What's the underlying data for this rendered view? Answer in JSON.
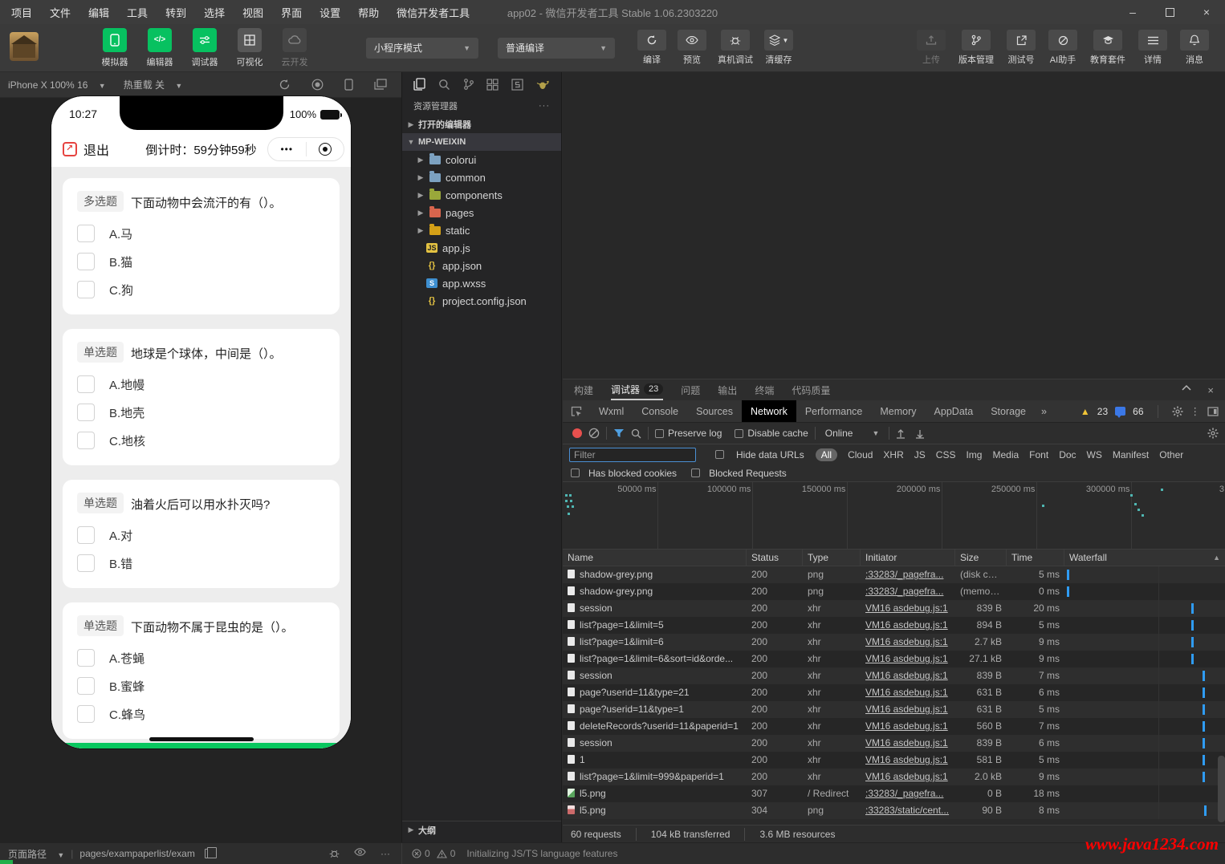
{
  "colors": {
    "accent_green": "#07c160",
    "waterfall_blue": "#2f9cf4",
    "warning_yellow": "#f0c437",
    "record_red": "#e8504e",
    "watermark_red": "#ff0000"
  },
  "window": {
    "title": "app02 - 微信开发者工具 Stable 1.06.2303220"
  },
  "menubar": {
    "items": [
      "项目",
      "文件",
      "编辑",
      "工具",
      "转到",
      "选择",
      "视图",
      "界面",
      "设置",
      "帮助",
      "微信开发者工具"
    ]
  },
  "toolbar": {
    "primary_buttons": [
      {
        "label": "模拟器",
        "icon": "phone-icon",
        "state": "green"
      },
      {
        "label": "编辑器",
        "icon": "code-icon",
        "state": "green"
      },
      {
        "label": "调试器",
        "icon": "sliders-icon",
        "state": "green"
      },
      {
        "label": "可视化",
        "icon": "layout-icon",
        "state": "grey"
      },
      {
        "label": "云开发",
        "icon": "cloud-icon",
        "state": "disabled"
      }
    ],
    "mode_select": "小程序模式",
    "compile_select": "普通编译",
    "action_buttons": [
      {
        "label": "编译",
        "icon": "compile-refresh-icon"
      },
      {
        "label": "预览",
        "icon": "eye-icon"
      },
      {
        "label": "真机调试",
        "icon": "bug-icon"
      },
      {
        "label": "清缓存",
        "icon": "layers-icon",
        "has_caret": true
      }
    ],
    "right_buttons": [
      {
        "label": "上传",
        "icon": "upload-icon",
        "enabled": false
      },
      {
        "label": "版本管理",
        "icon": "branch-icon",
        "enabled": true
      },
      {
        "label": "测试号",
        "icon": "external-icon",
        "enabled": true
      },
      {
        "label": "AI助手",
        "icon": "ai-icon",
        "enabled": true
      },
      {
        "label": "教育套件",
        "icon": "graduation-icon",
        "enabled": true
      },
      {
        "label": "详情",
        "icon": "list-icon",
        "enabled": true
      },
      {
        "label": "消息",
        "icon": "bell-icon",
        "enabled": true
      }
    ]
  },
  "simulator": {
    "device_select": "iPhone X 100% 16",
    "hot_reload": "热重载 关",
    "phone": {
      "status": {
        "time": "10:27",
        "battery": "100%"
      },
      "navbar": {
        "exit_label": "退出",
        "countdown": "倒计时：59分钟59秒",
        "menu_dots": "•••"
      },
      "questions": [
        {
          "badge": "多选题",
          "text": "下面动物中会流汗的有（）。",
          "options": [
            "A.马",
            "B.猫",
            "C.狗"
          ]
        },
        {
          "badge": "单选题",
          "text": "地球是个球体，中间是（）。",
          "options": [
            "A.地幔",
            "B.地壳",
            "C.地核"
          ]
        },
        {
          "badge": "单选题",
          "text": "油着火后可以用水扑灭吗?",
          "options": [
            "A.对",
            "B.错"
          ]
        },
        {
          "badge": "单选题",
          "text": "下面动物不属于昆虫的是（）。",
          "options": [
            "A.苍蝇",
            "B.蜜蜂",
            "C.蜂鸟"
          ]
        }
      ]
    }
  },
  "explorer": {
    "title": "资源管理器",
    "open_editors": "打开的编辑器",
    "project": "MP-WEIXIN",
    "outline": "大纲",
    "tree": [
      {
        "name": "colorui",
        "kind": "folder",
        "color": "#7ca1c0"
      },
      {
        "name": "common",
        "kind": "folder",
        "color": "#7ca1c0"
      },
      {
        "name": "components",
        "kind": "folder",
        "color": "#9aa83a"
      },
      {
        "name": "pages",
        "kind": "folder",
        "color": "#d9654d"
      },
      {
        "name": "static",
        "kind": "folder",
        "color": "#d4a017"
      },
      {
        "name": "app.js",
        "kind": "js"
      },
      {
        "name": "app.json",
        "kind": "json"
      },
      {
        "name": "app.wxss",
        "kind": "wxss"
      },
      {
        "name": "project.config.json",
        "kind": "json"
      }
    ]
  },
  "devtools": {
    "panel_tabs": [
      {
        "label": "构建"
      },
      {
        "label": "调试器",
        "badge": "23",
        "active": true
      },
      {
        "label": "问题"
      },
      {
        "label": "输出"
      },
      {
        "label": "终端"
      },
      {
        "label": "代码质量"
      }
    ],
    "inspector_tabs": [
      "Wxml",
      "Console",
      "Sources",
      "Network",
      "Performance",
      "Memory",
      "AppData",
      "Storage"
    ],
    "more_tabs": "»",
    "counts": {
      "warnings": "23",
      "messages": "66"
    },
    "network": {
      "preserve_log": "Preserve log",
      "disable_cache": "Disable cache",
      "throttling": "Online",
      "filter_placeholder": "Filter",
      "hide_data_urls": "Hide data URLs",
      "type_filters": [
        "All",
        "Cloud",
        "XHR",
        "JS",
        "CSS",
        "Img",
        "Media",
        "Font",
        "Doc",
        "WS",
        "Manifest",
        "Other"
      ],
      "blocked_cookies": "Has blocked cookies",
      "blocked_requests": "Blocked Requests",
      "timeline_ticks": [
        "50000 ms",
        "100000 ms",
        "150000 ms",
        "200000 ms",
        "250000 ms",
        "300000 ms"
      ],
      "timeline_edge": "3",
      "columns": [
        "Name",
        "Status",
        "Type",
        "Initiator",
        "Size",
        "Time",
        "Waterfall"
      ],
      "rows": [
        {
          "name": "shadow-grey.png",
          "status": "200",
          "type": "png",
          "initiator": ":33283/_pagefra...",
          "size": "(disk cac...",
          "time": "5 ms",
          "icon": "doc",
          "wf": "1.5"
        },
        {
          "name": "shadow-grey.png",
          "status": "200",
          "type": "png",
          "initiator": ":33283/_pagefra...",
          "size": "(memory ...",
          "time": "0 ms",
          "icon": "doc",
          "wf": "1.5"
        },
        {
          "name": "session",
          "status": "200",
          "type": "xhr",
          "initiator": "VM16 asdebug.js:1",
          "size": "839 B",
          "time": "20 ms",
          "icon": "doc",
          "wf": "79"
        },
        {
          "name": "list?page=1&limit=5",
          "status": "200",
          "type": "xhr",
          "initiator": "VM16 asdebug.js:1",
          "size": "894 B",
          "time": "5 ms",
          "icon": "doc",
          "wf": "79"
        },
        {
          "name": "list?page=1&limit=6",
          "status": "200",
          "type": "xhr",
          "initiator": "VM16 asdebug.js:1",
          "size": "2.7 kB",
          "time": "9 ms",
          "icon": "doc",
          "wf": "79"
        },
        {
          "name": "list?page=1&limit=6&sort=id&orde...",
          "status": "200",
          "type": "xhr",
          "initiator": "VM16 asdebug.js:1",
          "size": "27.1 kB",
          "time": "9 ms",
          "icon": "doc",
          "wf": "79"
        },
        {
          "name": "session",
          "status": "200",
          "type": "xhr",
          "initiator": "VM16 asdebug.js:1",
          "size": "839 B",
          "time": "7 ms",
          "icon": "doc",
          "wf": "86"
        },
        {
          "name": "page?userid=11&type=21",
          "status": "200",
          "type": "xhr",
          "initiator": "VM16 asdebug.js:1",
          "size": "631 B",
          "time": "6 ms",
          "icon": "doc",
          "wf": "86"
        },
        {
          "name": "page?userid=11&type=1",
          "status": "200",
          "type": "xhr",
          "initiator": "VM16 asdebug.js:1",
          "size": "631 B",
          "time": "5 ms",
          "icon": "doc",
          "wf": "86"
        },
        {
          "name": "deleteRecords?userid=11&paperid=1",
          "status": "200",
          "type": "xhr",
          "initiator": "VM16 asdebug.js:1",
          "size": "560 B",
          "time": "7 ms",
          "icon": "doc",
          "wf": "86"
        },
        {
          "name": "session",
          "status": "200",
          "type": "xhr",
          "initiator": "VM16 asdebug.js:1",
          "size": "839 B",
          "time": "6 ms",
          "icon": "doc",
          "wf": "86"
        },
        {
          "name": "1",
          "status": "200",
          "type": "xhr",
          "initiator": "VM16 asdebug.js:1",
          "size": "581 B",
          "time": "5 ms",
          "icon": "doc",
          "wf": "86"
        },
        {
          "name": "list?page=1&limit=999&paperid=1",
          "status": "200",
          "type": "xhr",
          "initiator": "VM16 asdebug.js:1",
          "size": "2.0 kB",
          "time": "9 ms",
          "icon": "doc",
          "wf": "86"
        },
        {
          "name": "l5.png",
          "status": "307",
          "type": "/ Redirect",
          "initiator": ":33283/_pagefra...",
          "size": "0 B",
          "time": "18 ms",
          "icon": "img-green",
          "wf": ""
        },
        {
          "name": "l5.png",
          "status": "304",
          "type": "png",
          "initiator": ":33283/static/cent...",
          "size": "90 B",
          "time": "8 ms",
          "icon": "img-red",
          "wf": "87"
        }
      ],
      "summary": [
        "60 requests",
        "104 kB transferred",
        "3.6 MB resources"
      ]
    }
  },
  "statusbar": {
    "left_label": "页面路径",
    "page_path": "pages/exampaperlist/exam",
    "errors": "0",
    "warnings": "0",
    "message": "Initializing JS/TS language features"
  },
  "watermark": "www.java1234.com"
}
